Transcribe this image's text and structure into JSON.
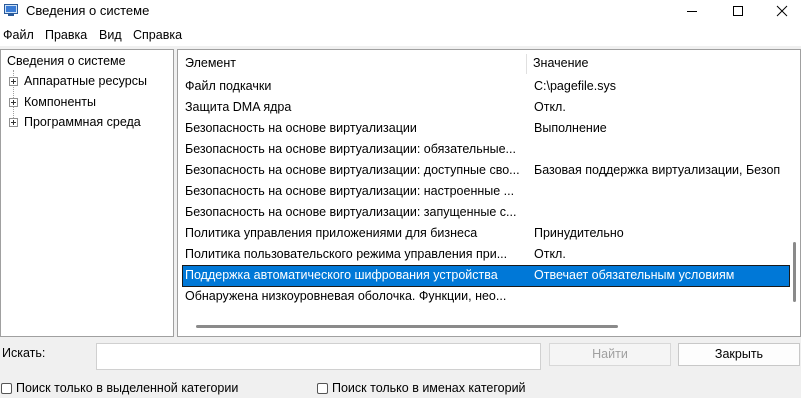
{
  "window": {
    "title": "Сведения о системе",
    "icons": [
      "system-information-app-icon",
      "minimize-icon",
      "maximize-icon",
      "close-icon"
    ]
  },
  "menu": [
    "Файл",
    "Правка",
    "Вид",
    "Справка"
  ],
  "tree": {
    "root": "Сведения о системе",
    "nodes": [
      "Аппаратные ресурсы",
      "Компоненты",
      "Программная среда"
    ]
  },
  "list": {
    "headers": {
      "element": "Элемент",
      "value": "Значение"
    },
    "rows": [
      {
        "element": "Файл подкачки",
        "value": "C:\\pagefile.sys"
      },
      {
        "element": "Защита DMA ядра",
        "value": "Откл."
      },
      {
        "element": "Безопасность на основе виртуализации",
        "value": "Выполнение"
      },
      {
        "element": "Безопасность на основе виртуализации: обязательные...",
        "value": ""
      },
      {
        "element": "Безопасность на основе виртуализации: доступные сво...",
        "value": "Базовая поддержка виртуализации, Безоп"
      },
      {
        "element": "Безопасность на основе виртуализации: настроенные ...",
        "value": ""
      },
      {
        "element": "Безопасность на основе виртуализации: запущенные с...",
        "value": ""
      },
      {
        "element": "Политика управления приложениями для бизнеса",
        "value": "Принудительно"
      },
      {
        "element": "Политика пользовательского режима управления при...",
        "value": "Откл."
      },
      {
        "element": "Поддержка автоматического шифрования устройства",
        "value": "Отвечает обязательным условиям"
      },
      {
        "element": "Обнаружена низкоуровневая оболочка. Функции, нео...",
        "value": ""
      }
    ],
    "selected_index": 9,
    "colors": {
      "selection": "#0078d7",
      "selection_text": "#ffffff"
    }
  },
  "search": {
    "label": "Искать:",
    "value": "",
    "find_button": "Найти",
    "close_button": "Закрыть",
    "checkbox_selected_category": "Поиск только в выделенной категории",
    "checkbox_category_names": "Поиск только в именах категорий"
  }
}
